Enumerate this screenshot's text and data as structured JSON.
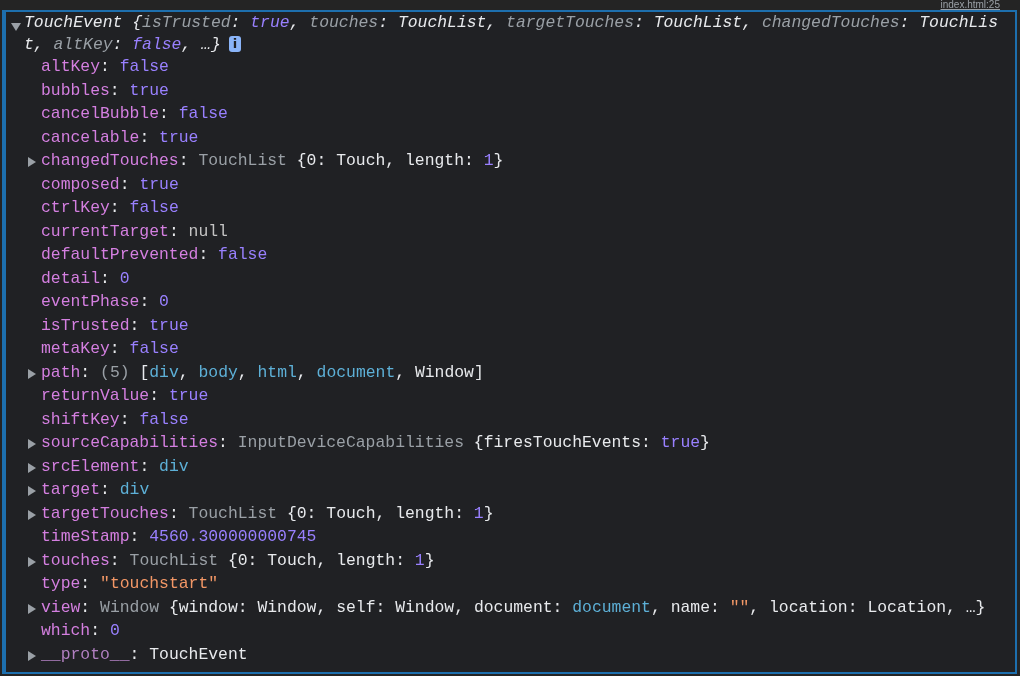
{
  "source_link": "index.html:25",
  "object": {
    "expanded": true,
    "info_badge": "i",
    "summary": [
      {
        "kind": "type",
        "t": "TouchEvent"
      },
      {
        "kind": "punct",
        "t": " {"
      },
      {
        "kind": "key",
        "t": "isTrusted"
      },
      {
        "kind": "punct",
        "t": ": "
      },
      {
        "kind": "bool",
        "t": "true"
      },
      {
        "kind": "punct",
        "t": ", "
      },
      {
        "kind": "key",
        "t": "touches"
      },
      {
        "kind": "punct",
        "t": ": "
      },
      {
        "kind": "plain",
        "t": "TouchList"
      },
      {
        "kind": "punct",
        "t": ", "
      },
      {
        "kind": "key",
        "t": "targetTouches"
      },
      {
        "kind": "punct",
        "t": ": "
      },
      {
        "kind": "plain",
        "t": "TouchList"
      },
      {
        "kind": "punct",
        "t": ", "
      },
      {
        "kind": "key",
        "t": "changedTouches"
      },
      {
        "kind": "punct",
        "t": ": "
      },
      {
        "kind": "plain",
        "t": "TouchList"
      },
      {
        "kind": "punct",
        "t": ", "
      },
      {
        "kind": "key",
        "t": "altKey"
      },
      {
        "kind": "punct",
        "t": ": "
      },
      {
        "kind": "bool",
        "t": "false"
      },
      {
        "kind": "punct",
        "t": ", …}"
      }
    ]
  },
  "properties": [
    {
      "key": "altKey",
      "expandable": false,
      "value": [
        {
          "kind": "punct",
          "t": ": "
        },
        {
          "kind": "bool",
          "t": "false"
        }
      ]
    },
    {
      "key": "bubbles",
      "expandable": false,
      "value": [
        {
          "kind": "punct",
          "t": ": "
        },
        {
          "kind": "bool",
          "t": "true"
        }
      ]
    },
    {
      "key": "cancelBubble",
      "expandable": false,
      "value": [
        {
          "kind": "punct",
          "t": ": "
        },
        {
          "kind": "bool",
          "t": "false"
        }
      ]
    },
    {
      "key": "cancelable",
      "expandable": false,
      "value": [
        {
          "kind": "punct",
          "t": ": "
        },
        {
          "kind": "bool",
          "t": "true"
        }
      ]
    },
    {
      "key": "changedTouches",
      "expandable": true,
      "value": [
        {
          "kind": "punct",
          "t": ": "
        },
        {
          "kind": "class",
          "t": "TouchList "
        },
        {
          "kind": "punct",
          "t": "{0: "
        },
        {
          "kind": "plain",
          "t": "Touch"
        },
        {
          "kind": "punct",
          "t": ", length: "
        },
        {
          "kind": "bool",
          "t": "1"
        },
        {
          "kind": "punct",
          "t": "}"
        }
      ]
    },
    {
      "key": "composed",
      "expandable": false,
      "value": [
        {
          "kind": "punct",
          "t": ": "
        },
        {
          "kind": "bool",
          "t": "true"
        }
      ]
    },
    {
      "key": "ctrlKey",
      "expandable": false,
      "value": [
        {
          "kind": "punct",
          "t": ": "
        },
        {
          "kind": "bool",
          "t": "false"
        }
      ]
    },
    {
      "key": "currentTarget",
      "expandable": false,
      "value": [
        {
          "kind": "punct",
          "t": ": "
        },
        {
          "kind": "null",
          "t": "null"
        }
      ]
    },
    {
      "key": "defaultPrevented",
      "expandable": false,
      "value": [
        {
          "kind": "punct",
          "t": ": "
        },
        {
          "kind": "bool",
          "t": "false"
        }
      ]
    },
    {
      "key": "detail",
      "expandable": false,
      "value": [
        {
          "kind": "punct",
          "t": ": "
        },
        {
          "kind": "bool",
          "t": "0"
        }
      ]
    },
    {
      "key": "eventPhase",
      "expandable": false,
      "value": [
        {
          "kind": "punct",
          "t": ": "
        },
        {
          "kind": "bool",
          "t": "0"
        }
      ]
    },
    {
      "key": "isTrusted",
      "expandable": false,
      "value": [
        {
          "kind": "punct",
          "t": ": "
        },
        {
          "kind": "bool",
          "t": "true"
        }
      ]
    },
    {
      "key": "metaKey",
      "expandable": false,
      "value": [
        {
          "kind": "punct",
          "t": ": "
        },
        {
          "kind": "bool",
          "t": "false"
        }
      ]
    },
    {
      "key": "path",
      "expandable": true,
      "value": [
        {
          "kind": "punct",
          "t": ": "
        },
        {
          "kind": "class",
          "t": "(5) "
        },
        {
          "kind": "punct",
          "t": "["
        },
        {
          "kind": "node",
          "t": "div"
        },
        {
          "kind": "punct",
          "t": ", "
        },
        {
          "kind": "node",
          "t": "body"
        },
        {
          "kind": "punct",
          "t": ", "
        },
        {
          "kind": "node",
          "t": "html"
        },
        {
          "kind": "punct",
          "t": ", "
        },
        {
          "kind": "node",
          "t": "document"
        },
        {
          "kind": "punct",
          "t": ", "
        },
        {
          "kind": "plain",
          "t": "Window"
        },
        {
          "kind": "punct",
          "t": "]"
        }
      ]
    },
    {
      "key": "returnValue",
      "expandable": false,
      "value": [
        {
          "kind": "punct",
          "t": ": "
        },
        {
          "kind": "bool",
          "t": "true"
        }
      ]
    },
    {
      "key": "shiftKey",
      "expandable": false,
      "value": [
        {
          "kind": "punct",
          "t": ": "
        },
        {
          "kind": "bool",
          "t": "false"
        }
      ]
    },
    {
      "key": "sourceCapabilities",
      "expandable": true,
      "value": [
        {
          "kind": "punct",
          "t": ": "
        },
        {
          "kind": "class",
          "t": "InputDeviceCapabilities "
        },
        {
          "kind": "punct",
          "t": "{firesTouchEvents: "
        },
        {
          "kind": "bool",
          "t": "true"
        },
        {
          "kind": "punct",
          "t": "}"
        }
      ]
    },
    {
      "key": "srcElement",
      "expandable": true,
      "value": [
        {
          "kind": "punct",
          "t": ": "
        },
        {
          "kind": "node",
          "t": "div"
        }
      ]
    },
    {
      "key": "target",
      "expandable": true,
      "value": [
        {
          "kind": "punct",
          "t": ": "
        },
        {
          "kind": "node",
          "t": "div"
        }
      ]
    },
    {
      "key": "targetTouches",
      "expandable": true,
      "value": [
        {
          "kind": "punct",
          "t": ": "
        },
        {
          "kind": "class",
          "t": "TouchList "
        },
        {
          "kind": "punct",
          "t": "{0: "
        },
        {
          "kind": "plain",
          "t": "Touch"
        },
        {
          "kind": "punct",
          "t": ", length: "
        },
        {
          "kind": "bool",
          "t": "1"
        },
        {
          "kind": "punct",
          "t": "}"
        }
      ]
    },
    {
      "key": "timeStamp",
      "expandable": false,
      "value": [
        {
          "kind": "punct",
          "t": ": "
        },
        {
          "kind": "bool",
          "t": "4560.300000000745"
        }
      ]
    },
    {
      "key": "touches",
      "expandable": true,
      "value": [
        {
          "kind": "punct",
          "t": ": "
        },
        {
          "kind": "class",
          "t": "TouchList "
        },
        {
          "kind": "punct",
          "t": "{0: "
        },
        {
          "kind": "plain",
          "t": "Touch"
        },
        {
          "kind": "punct",
          "t": ", length: "
        },
        {
          "kind": "bool",
          "t": "1"
        },
        {
          "kind": "punct",
          "t": "}"
        }
      ]
    },
    {
      "key": "type",
      "expandable": false,
      "value": [
        {
          "kind": "punct",
          "t": ": "
        },
        {
          "kind": "string",
          "t": "\"touchstart\""
        }
      ]
    },
    {
      "key": "view",
      "expandable": true,
      "value": [
        {
          "kind": "punct",
          "t": ": "
        },
        {
          "kind": "class",
          "t": "Window "
        },
        {
          "kind": "punct",
          "t": "{window: "
        },
        {
          "kind": "plain",
          "t": "Window"
        },
        {
          "kind": "punct",
          "t": ", self: "
        },
        {
          "kind": "plain",
          "t": "Window"
        },
        {
          "kind": "punct",
          "t": ", document: "
        },
        {
          "kind": "node",
          "t": "document"
        },
        {
          "kind": "punct",
          "t": ", name: "
        },
        {
          "kind": "string",
          "t": "\"\""
        },
        {
          "kind": "punct",
          "t": ", location: "
        },
        {
          "kind": "plain",
          "t": "Location"
        },
        {
          "kind": "punct",
          "t": ", …}"
        }
      ]
    },
    {
      "key": "which",
      "expandable": false,
      "value": [
        {
          "kind": "punct",
          "t": ": "
        },
        {
          "kind": "bool",
          "t": "0"
        }
      ]
    },
    {
      "key": "__proto__",
      "expandable": true,
      "dim": true,
      "value": [
        {
          "kind": "punct",
          "t": ": "
        },
        {
          "kind": "plain",
          "t": "TouchEvent"
        }
      ]
    }
  ]
}
